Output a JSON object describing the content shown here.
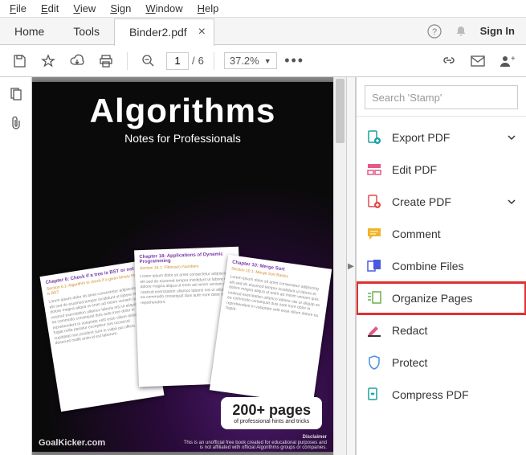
{
  "menu": {
    "items": [
      "File",
      "Edit",
      "View",
      "Sign",
      "Window",
      "Help"
    ]
  },
  "tabs": {
    "home": "Home",
    "tools": "Tools",
    "document": "Binder2.pdf",
    "signin": "Sign In"
  },
  "toolbar": {
    "current_page": "1",
    "page_sep": "/",
    "total_pages": "6",
    "zoom": "37.2%"
  },
  "cover": {
    "title": "Algorithms",
    "subtitle": "Notes for Professionals",
    "card1_heading": "Chapter 6: Check if a tree is BST or not",
    "card1_sub": "Section 6.1: Algorithm to check if a given binary tree is BST",
    "card2_heading": "Chapter 18: Applications of Dynamic Programming",
    "card2_sub": "Section 18.1: Fibonacci Numbers",
    "card3_heading": "Chapter 10: Merge Sort",
    "card3_sub": "Section 10.1: Merge Sort Basics",
    "badge_big": "200+ pages",
    "badge_small": "of professional hints and tricks",
    "footer_site": "GoalKicker.com",
    "footer_disclaimer_label": "Disclaimer",
    "footer_disclaimer_text": "This is an unofficial free book created for educational purposes and is not affiliated with official Algorithms groups or companies."
  },
  "right": {
    "search_placeholder": "Search 'Stamp'",
    "tools": [
      {
        "label": "Export PDF",
        "expandable": true,
        "color": "#18a0a0"
      },
      {
        "label": "Edit PDF",
        "expandable": false,
        "color": "#e05a8a"
      },
      {
        "label": "Create PDF",
        "expandable": true,
        "color": "#e04a4a"
      },
      {
        "label": "Comment",
        "expandable": false,
        "color": "#f0b428"
      },
      {
        "label": "Combine Files",
        "expandable": false,
        "color": "#4a5ae0"
      },
      {
        "label": "Organize Pages",
        "expandable": false,
        "color": "#6ab04a",
        "highlight": true
      },
      {
        "label": "Redact",
        "expandable": false,
        "color": "#e05a8a"
      },
      {
        "label": "Protect",
        "expandable": false,
        "color": "#4a90e2"
      },
      {
        "label": "Compress PDF",
        "expandable": false,
        "color": "#18a0a0"
      }
    ]
  }
}
